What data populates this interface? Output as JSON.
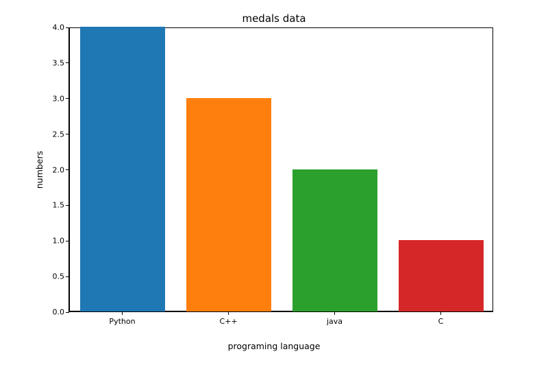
{
  "chart_data": {
    "type": "bar",
    "title": "medals data",
    "xlabel": "programing language",
    "ylabel": "numbers",
    "categories": [
      "Python",
      "C++",
      "java",
      "C"
    ],
    "values": [
      4,
      3,
      2,
      1
    ],
    "colors": [
      "#1f77b4",
      "#ff7f0e",
      "#2ca02c",
      "#d62728"
    ],
    "ylim": [
      0.0,
      4.0
    ],
    "yticks": [
      0.0,
      0.5,
      1.0,
      1.5,
      2.0,
      2.5,
      3.0,
      3.5,
      4.0
    ],
    "ytick_labels": [
      "0.0",
      "0.5",
      "1.0",
      "1.5",
      "2.0",
      "2.5",
      "3.0",
      "3.5",
      "4.0"
    ]
  }
}
